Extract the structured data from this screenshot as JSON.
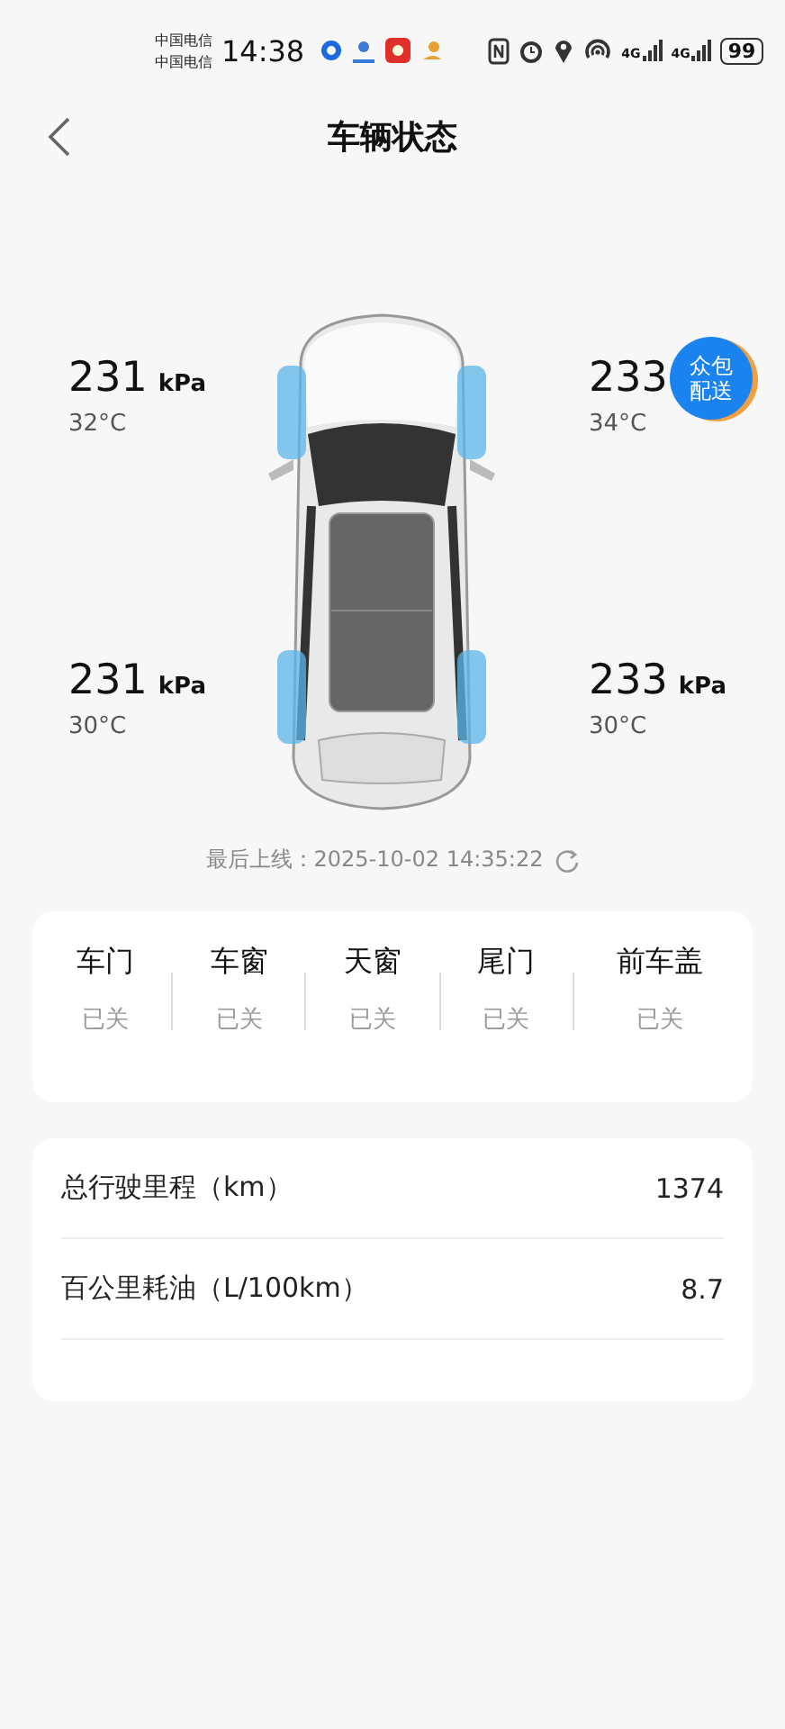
{
  "status_bar": {
    "carriers": [
      "中国电信",
      "中国电信"
    ],
    "time": "14:38",
    "signals": [
      "4G",
      "4G"
    ],
    "battery": "99"
  },
  "header": {
    "title": "车辆状态"
  },
  "tires": [
    {
      "pressure": "231",
      "unit": "kPa",
      "temperature": "32°C"
    },
    {
      "pressure": "233",
      "temperature": "34°C"
    },
    {
      "pressure": "231",
      "unit": "kPa",
      "temperature": "30°C"
    },
    {
      "pressure": "233",
      "unit": "kPa",
      "temperature": "30°C"
    }
  ],
  "floating_badge": {
    "label": "众包配送"
  },
  "last_online": "最后上线：2025-10-02 14:35:22",
  "openings": [
    {
      "label": "车门",
      "state": "已关"
    },
    {
      "label": "车窗",
      "state": "已关"
    },
    {
      "label": "天窗",
      "state": "已关"
    },
    {
      "label": "尾门",
      "state": "已关"
    },
    {
      "label": "前车盖",
      "state": "已关"
    }
  ],
  "stats": [
    {
      "label": "总行驶里程（km）",
      "value": "1374"
    },
    {
      "label": "百公里耗油（L/100km）",
      "value": "8.7"
    }
  ]
}
